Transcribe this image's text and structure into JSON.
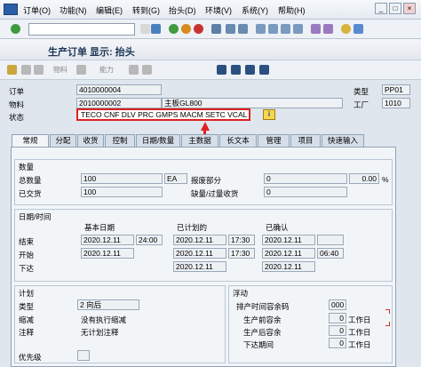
{
  "menu": {
    "items": [
      "订单(O)",
      "功能(N)",
      "编辑(E)",
      "转到(G)",
      "抬头(D)",
      "环境(V)",
      "系统(Y)",
      "帮助(H)"
    ]
  },
  "header": {
    "title": "生产订单 显示: 抬头",
    "material_btn": "物料",
    "capacity_btn": "能力"
  },
  "order": {
    "order_label": "订单",
    "order_value": "4010000004",
    "type_label": "类型",
    "type_value": "PP01",
    "material_label": "物料",
    "material_value": "2010000002",
    "material_desc": "主板GL800",
    "plant_label": "工厂",
    "plant_value": "1010",
    "status_label": "状态",
    "status_value": "TECO CNF  DLV  PRC  GMPS MACM SETC VCAL"
  },
  "tabs": [
    "常规",
    "分配",
    "收货",
    "控制",
    "日期/数量",
    "主数据",
    "长文本",
    "管理",
    "项目",
    "快速输入"
  ],
  "quantity": {
    "title": "数量",
    "total_label": "总数量",
    "total_value": "100",
    "unit": "EA",
    "scrap_label": "报废部分",
    "scrap_value": "0",
    "scrap_pct": "0.00",
    "pct": "%",
    "delivered_label": "已交货",
    "delivered_value": "100",
    "short_label": "缺量/过量收货",
    "short_value": "0"
  },
  "dates": {
    "title": "日期/时间",
    "col_basic": "基本日期",
    "col_scheduled": "已计划的",
    "col_confirmed": "已确认",
    "end_label": "结束",
    "start_label": "开始",
    "release_label": "下达",
    "end_basic_date": "2020.12.11",
    "end_basic_time": "24:00",
    "end_sched_date": "2020.12.11",
    "end_sched_time": "17:30",
    "end_conf_date": "2020.12.11",
    "start_basic_date": "2020.12.11",
    "start_sched_date": "2020.12.11",
    "start_sched_time": "17:30",
    "start_conf_date": "2020.12.11",
    "start_conf_time": "06:40",
    "release_sched_date": "2020.12.11",
    "release_conf_date": "2020.12.11"
  },
  "plan": {
    "title": "计划",
    "type_label": "类型",
    "type_value": "2 向后",
    "reduction_label": "缩减",
    "reduction_value": "没有执行缩减",
    "note_label": "注释",
    "note_value": "无计划注释",
    "priority_label": "优先级"
  },
  "float": {
    "title": "浮动",
    "sched_margin_label": "排产时间容余码",
    "sched_margin_value": "000",
    "before_label": "生产前容余",
    "before_value": "0",
    "after_label": "生产后容余",
    "after_value": "0",
    "release_label": "下达期间",
    "release_value": "0",
    "unit": "工作日"
  }
}
